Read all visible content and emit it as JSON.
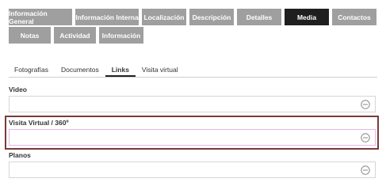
{
  "main_tabs_row1": [
    {
      "label": "Información General",
      "active": false
    },
    {
      "label": "Información Interna",
      "active": false
    },
    {
      "label": "Localización",
      "active": false
    },
    {
      "label": "Descripción",
      "active": false
    },
    {
      "label": "Detalles",
      "active": false
    },
    {
      "label": "Media",
      "active": true
    },
    {
      "label": "Contactos",
      "active": false
    }
  ],
  "main_tabs_row2": [
    {
      "label": "Notas",
      "active": false
    },
    {
      "label": "Actividad",
      "active": false
    },
    {
      "label": "Información",
      "active": false
    }
  ],
  "sub_tabs": [
    {
      "label": "Fotografías",
      "active": false
    },
    {
      "label": "Documentos",
      "active": false
    },
    {
      "label": "Links",
      "active": true
    },
    {
      "label": "Visita virtual",
      "active": false
    }
  ],
  "fields": {
    "video": {
      "label": "Video",
      "value": ""
    },
    "virtual_tour": {
      "label": "Visita Virtual / 360º",
      "value": ""
    },
    "plans": {
      "label": "Planos",
      "value": ""
    }
  },
  "icons": {
    "field_action": "ellipsis-circle-icon"
  },
  "colors": {
    "tab_bg": "#9f9f9f",
    "tab_active_bg": "#1f1f1f",
    "highlight_border": "#7a3a3a"
  }
}
